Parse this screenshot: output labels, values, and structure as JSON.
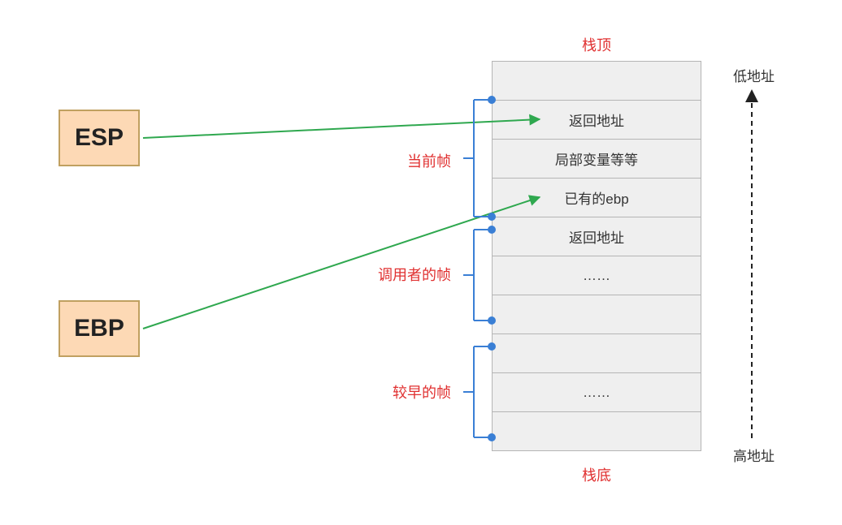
{
  "registers": {
    "esp": "ESP",
    "ebp": "EBP"
  },
  "stack_cells": [
    "",
    "返回地址",
    "局部变量等等",
    "已有的ebp",
    "返回地址",
    "……",
    "",
    "",
    "……",
    ""
  ],
  "labels": {
    "top": "栈顶",
    "bottom": "栈底",
    "low_addr": "低地址",
    "high_addr": "高地址"
  },
  "groups": {
    "current": "当前帧",
    "caller": "调用者的帧",
    "earlier": "较早的帧"
  }
}
